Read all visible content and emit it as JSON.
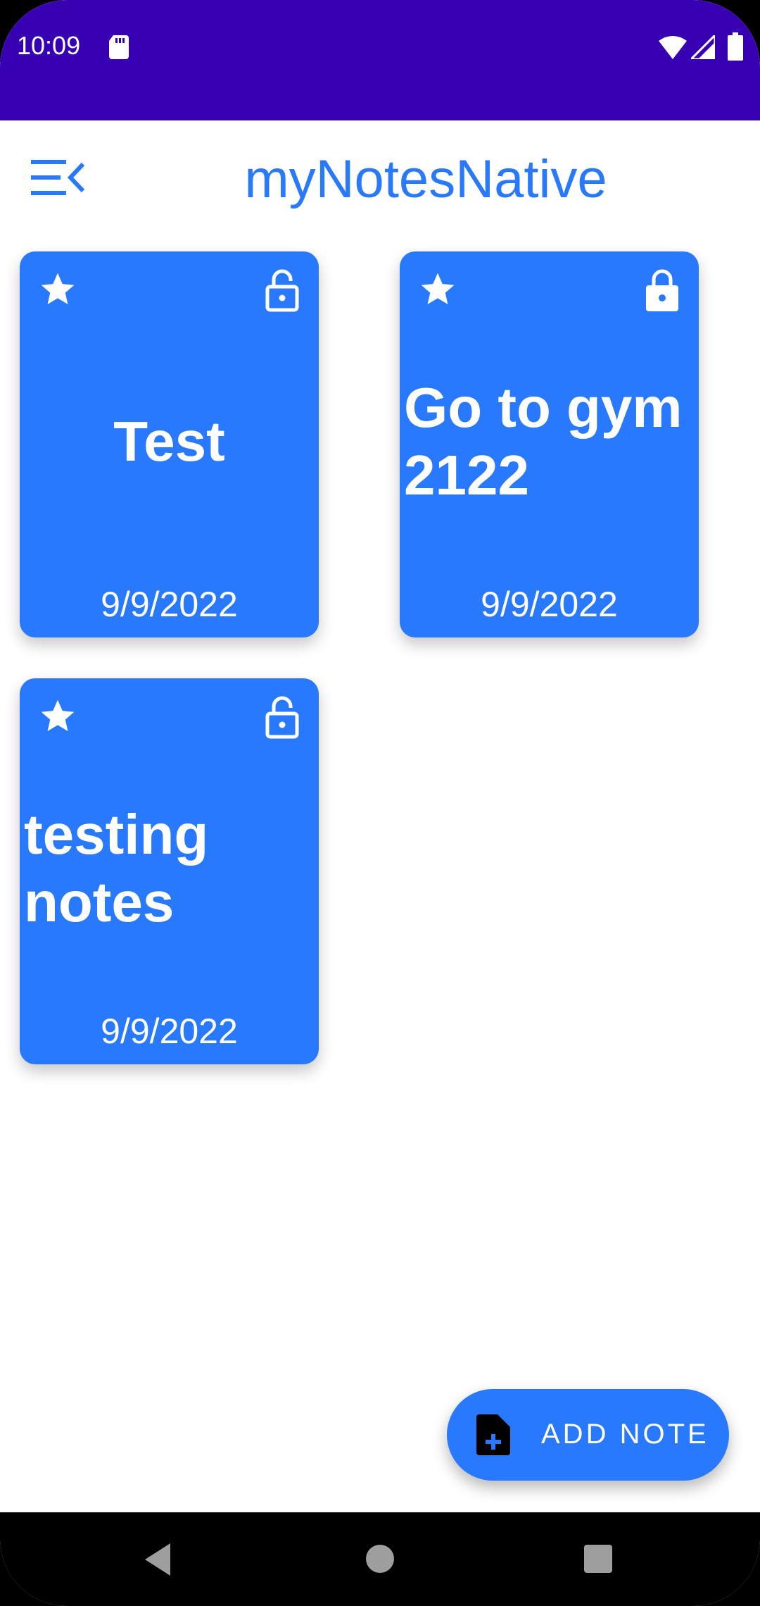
{
  "status_bar": {
    "time": "10:09",
    "icons": [
      "sd-card-icon",
      "wifi-icon",
      "signal-icon",
      "battery-icon"
    ],
    "background": "#3700b3"
  },
  "header": {
    "title": "myNotesNative",
    "menu_icon": "menu-collapse-icon",
    "title_color": "#2979ff"
  },
  "notes": [
    {
      "title": "Test",
      "date": "9/9/2022",
      "favorite": true,
      "locked": false
    },
    {
      "title": "Go to gym 2122",
      "date": "9/9/2022",
      "favorite": true,
      "locked": true
    },
    {
      "title": "testing notes",
      "date": "9/9/2022",
      "favorite": true,
      "locked": false
    }
  ],
  "fab": {
    "label": "ADD NOTE",
    "icon": "add-note-icon"
  },
  "nav_bar": {
    "buttons": [
      "back-icon",
      "home-icon",
      "recents-icon"
    ]
  },
  "colors": {
    "accent": "#2979ff",
    "status_bar": "#3700b3",
    "card_text": "#ffffff"
  }
}
